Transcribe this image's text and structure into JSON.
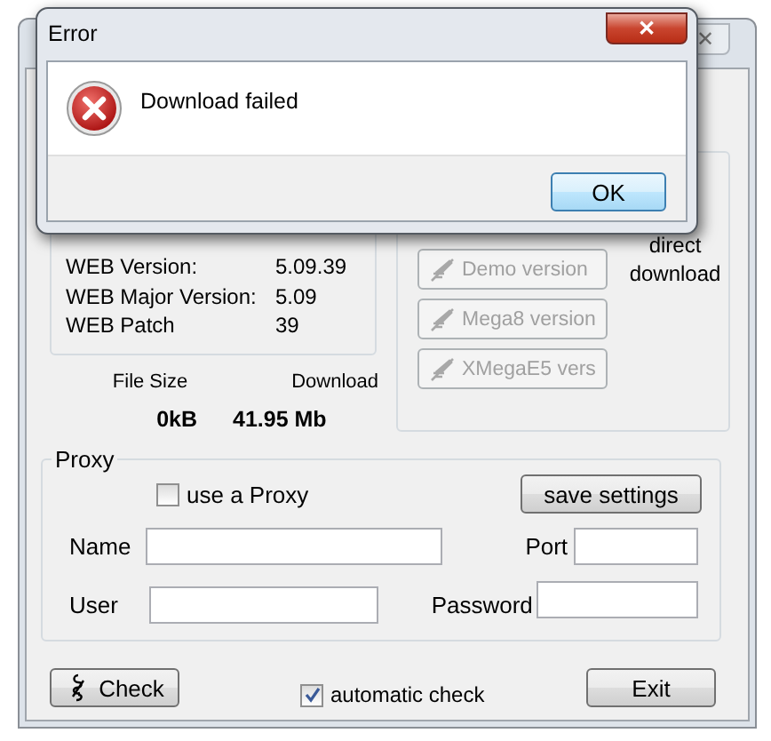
{
  "main_window": {
    "close_label": "✕",
    "web_info": [
      {
        "label": "WEB Version:",
        "value": "5.09.39"
      },
      {
        "label": "WEB Major Version:",
        "value": "5.09"
      },
      {
        "label": "WEB Patch",
        "value": "39"
      }
    ],
    "file_size": {
      "label": "File Size",
      "value": "0kB"
    },
    "download": {
      "label": "Download",
      "value": "41.95 Mb"
    },
    "download_buttons": [
      {
        "label": "Demo version",
        "disabled": true
      },
      {
        "label": "Mega8 version",
        "disabled": true
      },
      {
        "label": "XMegaE5 vers",
        "disabled": true
      }
    ],
    "direct_download": "direct download",
    "proxy": {
      "title": "Proxy",
      "use_proxy": {
        "label": "use a Proxy",
        "checked": false
      },
      "save_button": "save settings",
      "rows": [
        [
          {
            "label": "Name"
          },
          {
            "label": "Port"
          }
        ],
        [
          {
            "label": "User"
          },
          {
            "label": "Password"
          }
        ]
      ]
    },
    "check_button": "Check",
    "automatic_check": {
      "label": "automatic check",
      "checked": true
    },
    "exit_button": "Exit"
  },
  "error_dialog": {
    "title": "Error",
    "close_label": "✕",
    "message": "Download failed",
    "buttons": [
      {
        "label": "OK",
        "focused": true
      }
    ]
  }
}
